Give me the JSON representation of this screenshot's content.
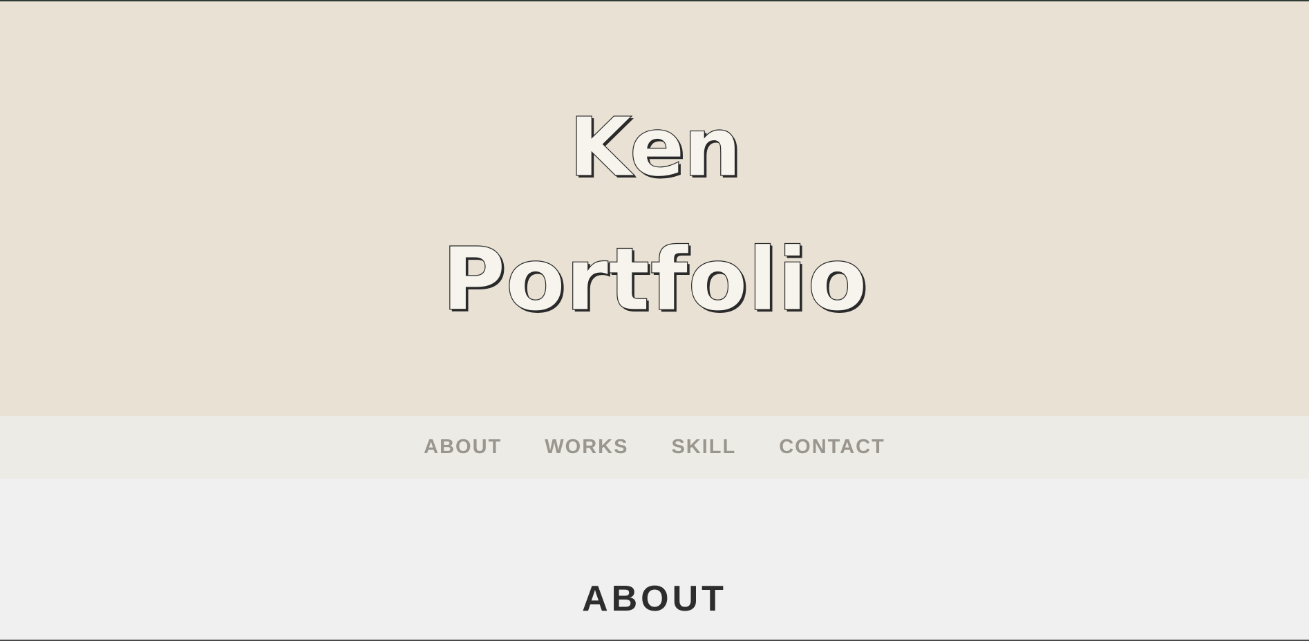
{
  "hero": {
    "name": "Ken",
    "subtitle": "Portfolio"
  },
  "nav": {
    "items": [
      {
        "label": "ABOUT"
      },
      {
        "label": "WORKS"
      },
      {
        "label": "SKILL"
      },
      {
        "label": "CONTACT"
      }
    ]
  },
  "about": {
    "title": "ABOUT"
  },
  "colors": {
    "hero_background": "#e9e2d4",
    "nav_background": "#ecebe6",
    "nav_text": "#9a958d",
    "page_background": "#f0f0f0",
    "title_text": "#2d2d2d"
  }
}
